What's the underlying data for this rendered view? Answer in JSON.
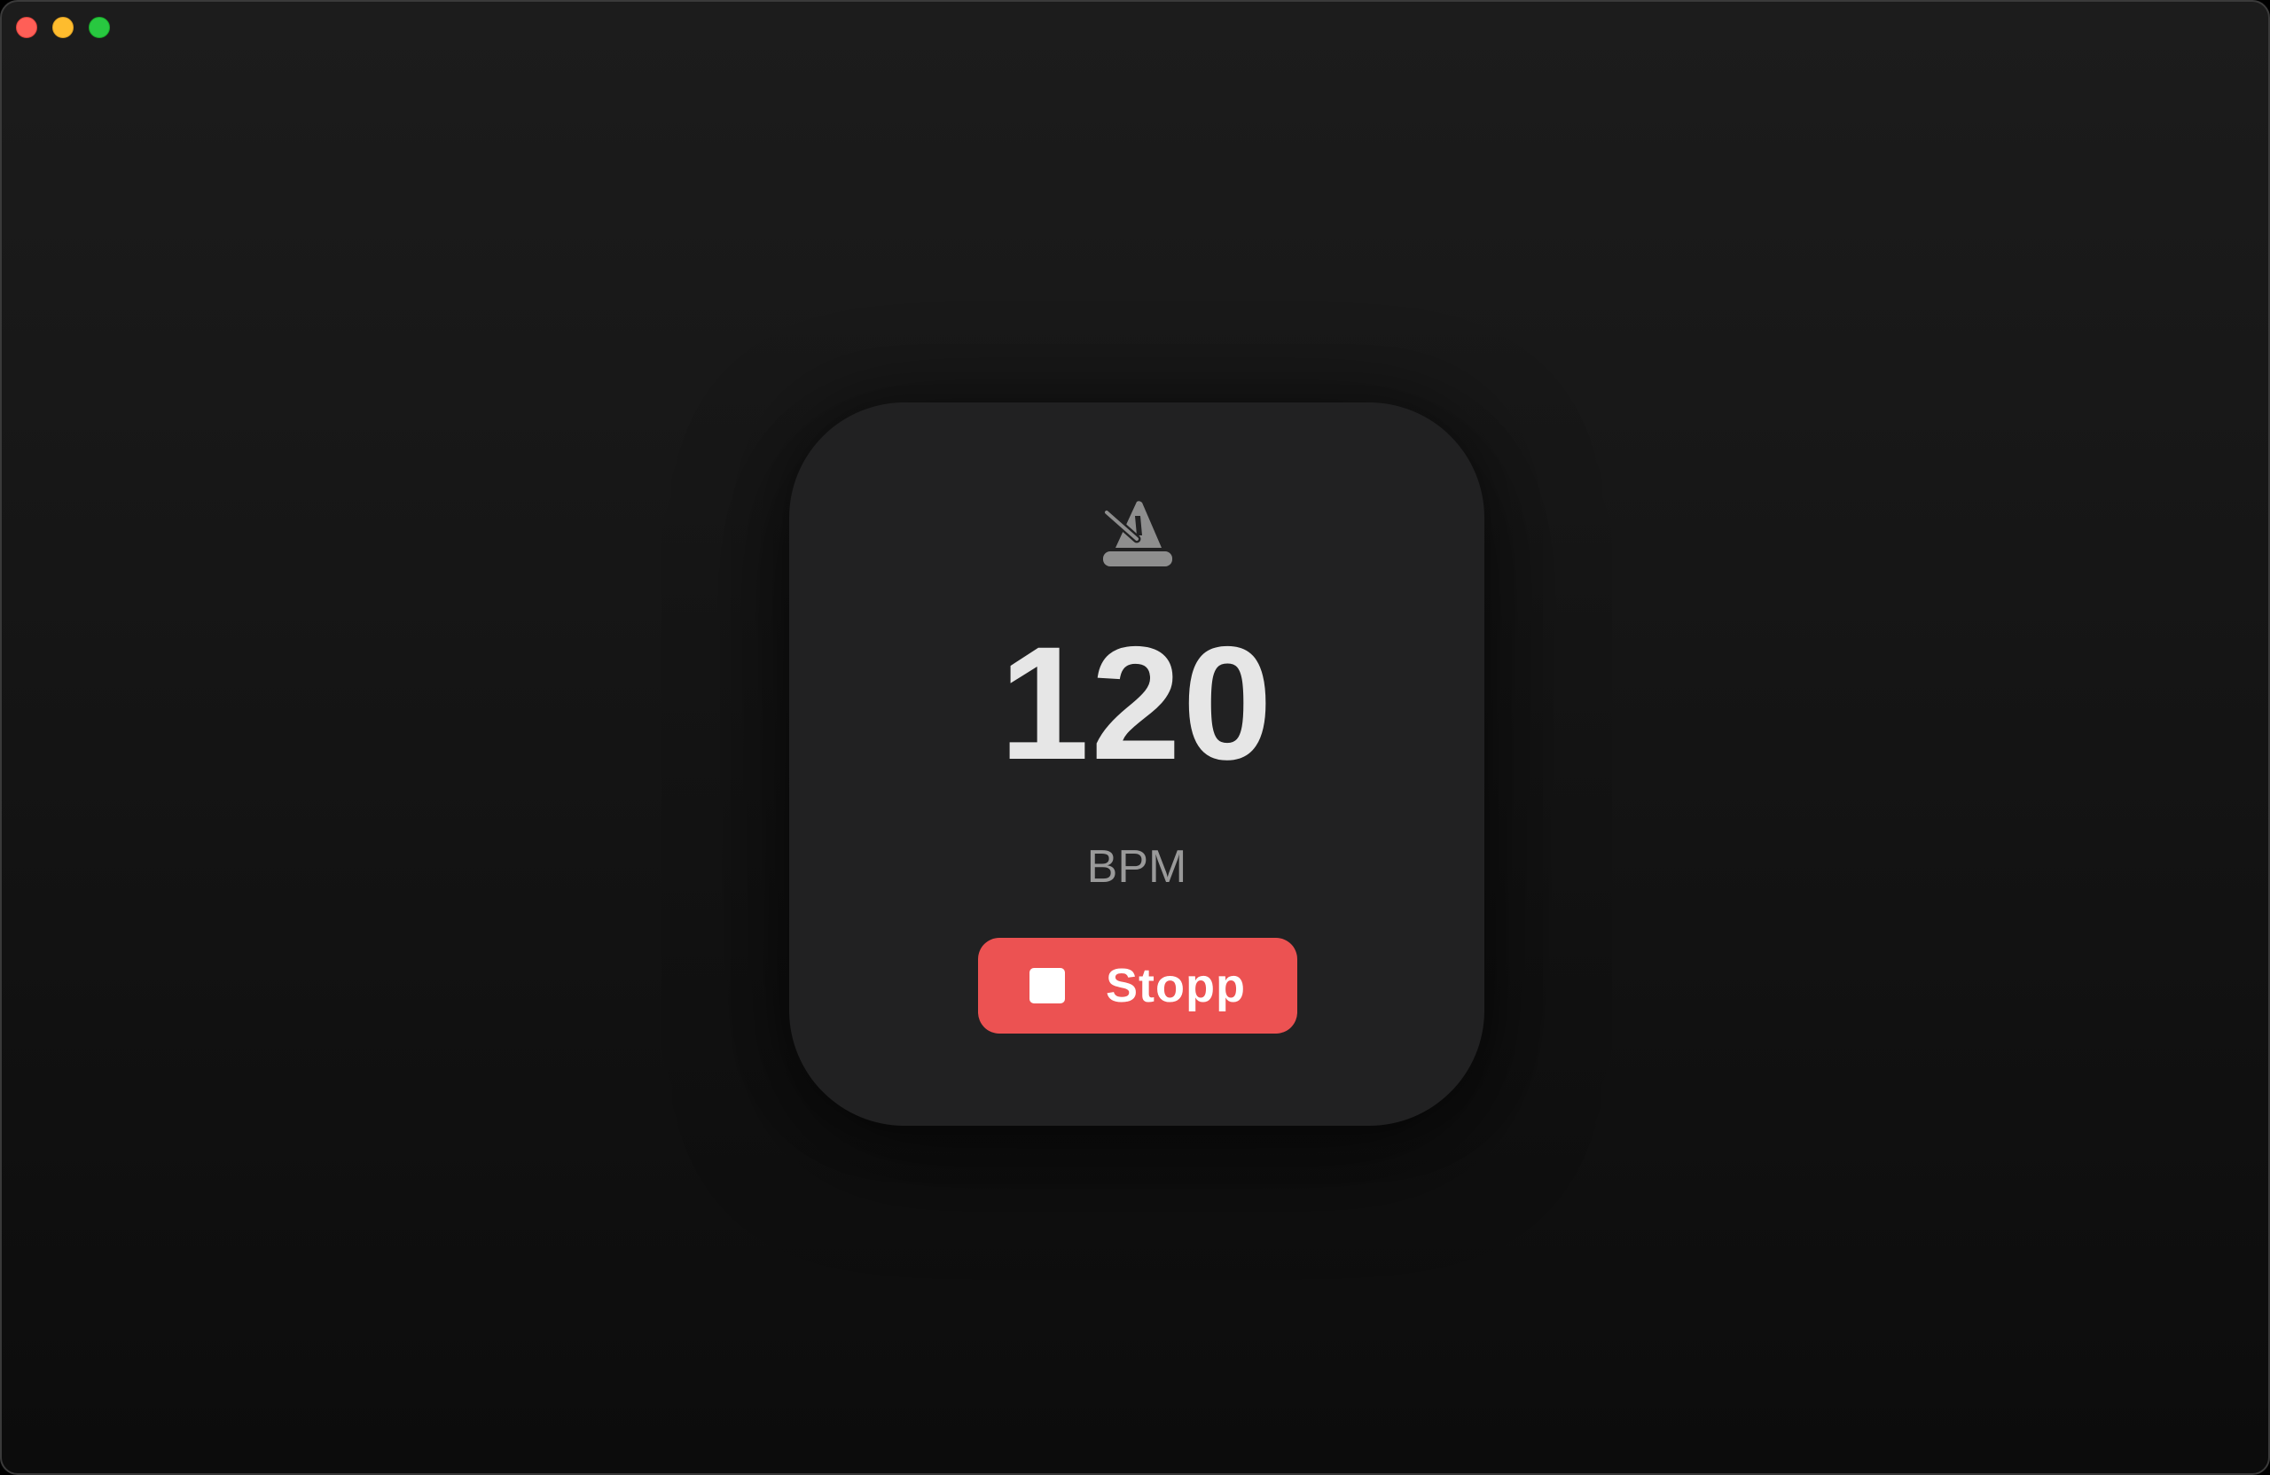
{
  "window": {
    "controls": [
      "close",
      "minimize",
      "zoom"
    ]
  },
  "metronome": {
    "icon": "metronome-icon",
    "bpm_value": "120",
    "bpm_unit": "BPM",
    "stop_label": "Stopp",
    "stop_icon": "stop-icon"
  },
  "colors": {
    "accent": "#ec5252",
    "card_bg": "#212122",
    "value_text": "#e6e6e6",
    "unit_text": "#9a9a9a",
    "icon": "#8e8e8e"
  }
}
